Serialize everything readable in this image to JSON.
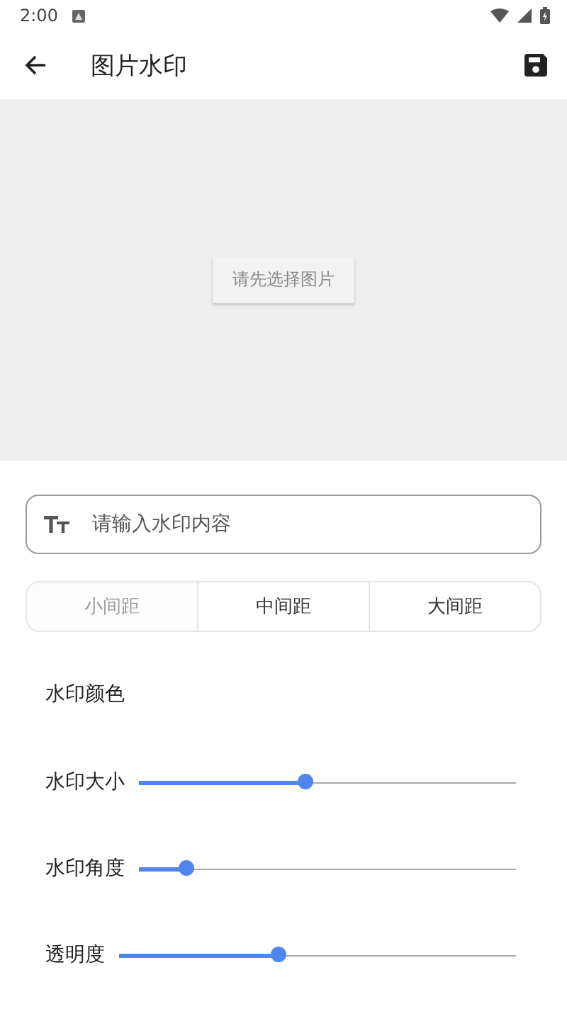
{
  "status_bar": {
    "time": "2:00"
  },
  "toolbar": {
    "title": "图片水印"
  },
  "preview": {
    "button": "请先选择图片"
  },
  "watermark_input": {
    "placeholder": "请输入水印内容"
  },
  "spacing_tabs": [
    {
      "label": "小间距",
      "selected": true
    },
    {
      "label": "中间距",
      "selected": false
    },
    {
      "label": "大间距",
      "selected": false
    }
  ],
  "color_label": "水印颜色",
  "sliders": [
    {
      "label": "水印大小",
      "level": 0.44
    },
    {
      "label": "水印角度",
      "level": 0.125
    },
    {
      "label": "透明度",
      "level": 0.4
    }
  ]
}
